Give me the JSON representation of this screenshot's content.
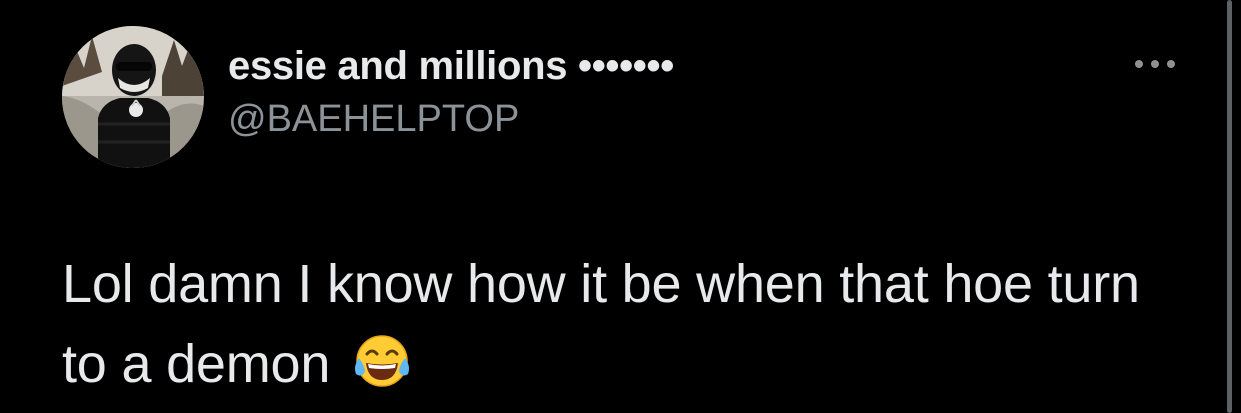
{
  "tweet": {
    "display_name": "essie and millions •••••••",
    "handle": "@BAEHELPTOP",
    "text": "Lol damn I know how it be when that hoe turn to a demon",
    "emoji": "face-with-tears-of-joy-icon"
  },
  "icons": {
    "more": "more-horizontal-icon"
  },
  "colors": {
    "background": "#000000",
    "primary_text": "#e7e9ea",
    "secondary_text": "#8b9298"
  }
}
